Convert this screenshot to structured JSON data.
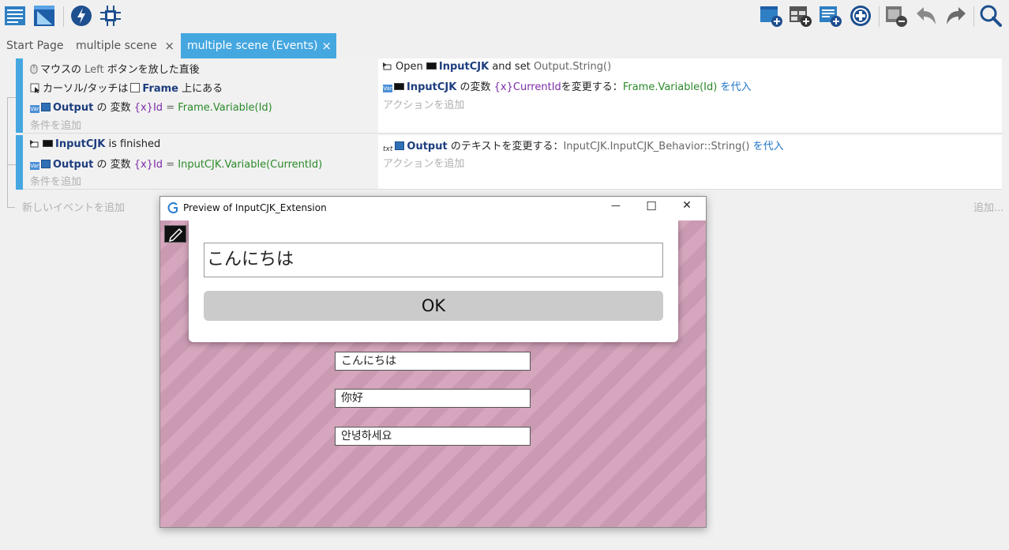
{
  "toolbar": {
    "left_icons": [
      "project-manager-icon",
      "scene-window-icon",
      "events-extension-icon",
      "debugger-icon"
    ],
    "right_icons": [
      "add-event-icon",
      "add-subevent-icon",
      "add-comment-icon",
      "add-more-icon",
      "delete-event-icon",
      "undo-icon",
      "redo-icon",
      "search-icon"
    ]
  },
  "tabs": [
    {
      "label": "Start Page",
      "closable": false,
      "active": false
    },
    {
      "label": "multiple scene",
      "closable": true,
      "active": false
    },
    {
      "label": "multiple scene (Events)",
      "closable": true,
      "active": true
    }
  ],
  "tab_close_glyph": "×",
  "events": {
    "event1": {
      "cond1": {
        "a": "マウスの",
        "b": "Left",
        "c": "ボタンを放した直後"
      },
      "cond2": {
        "a": "カーソル/タッチは",
        "obj": "Frame",
        "c": "上にある"
      },
      "cond3": {
        "obj": "Output",
        "a": "の 変数",
        "var": "Id",
        "eq": "=",
        "val": "Frame.Variable(Id)"
      },
      "add_condition": "条件を追加",
      "act1": {
        "a": "Open",
        "obj": "InputCJK",
        "b": "and set",
        "c": "Output.String()"
      },
      "act2": {
        "obj": "InputCJK",
        "a": "の変数",
        "var": "CurrentId",
        "b": "を変更する：",
        "val": "Frame.Variable(Id)",
        "op": "を代入"
      },
      "add_action": "アクションを追加"
    },
    "event2": {
      "cond1": {
        "obj": "InputCJK",
        "a": "is finished"
      },
      "cond2": {
        "obj": "Output",
        "a": "の 変数",
        "var": "Id",
        "eq": "=",
        "val": "InputCJK.Variable(CurrentId)"
      },
      "add_condition": "条件を追加",
      "act1": {
        "obj": "Output",
        "a": "のテキストを変更する：",
        "val": "InputCJK.InputCJK_Behavior::String()",
        "op": "を代入"
      },
      "add_action": "アクションを追加"
    },
    "add_new_event": "新しいイベントを追加",
    "add_more": "追加..."
  },
  "preview": {
    "title": "Preview of InputCJK_Extension",
    "controls": {
      "minimize": "—",
      "maximize": "☐",
      "close": "✕"
    },
    "dialog_input": "こんにちは",
    "dialog_ok": "OK",
    "textboxes": [
      "こんにちは",
      "你好",
      "안녕하세요"
    ]
  },
  "colors": {
    "accent": "#45a7e0",
    "canvas": "#d5a6bd",
    "object": "#1d3d7d",
    "expression": "#2a8a2a",
    "variable": "#7d2ba8",
    "operator": "#2276c8"
  }
}
